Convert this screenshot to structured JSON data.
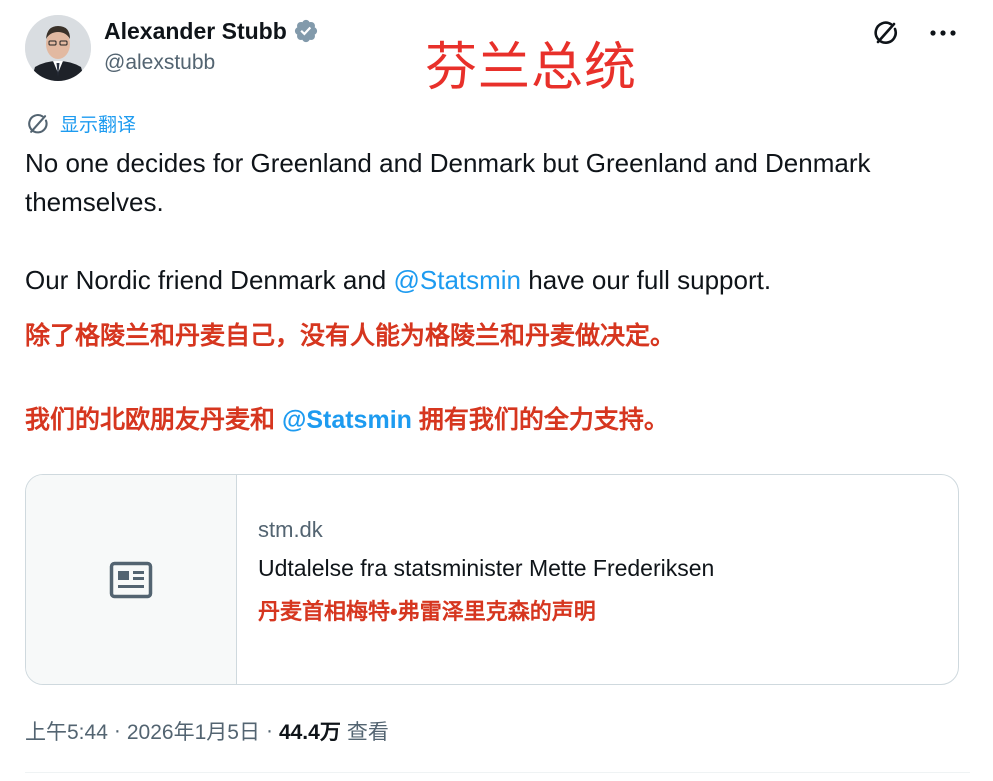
{
  "author": {
    "name": "Alexander Stubb",
    "handle": "@alexstubb",
    "verified_color": "#829aab"
  },
  "overlay_title": "芬兰总统",
  "icons": {
    "top_right": [
      "grok-icon",
      "more-options-icon"
    ],
    "translate": "translate-icon",
    "card_thumbnail": "article-icon"
  },
  "translate_label": "显示翻译",
  "tweet": {
    "line1": "No one decides for Greenland and Denmark but Greenland and Denmark themselves.",
    "line2_before": "Our Nordic friend Denmark and ",
    "line2_mention": "@Statsmin",
    "line2_after": " have our full support."
  },
  "translation": {
    "line1": "除了格陵兰和丹麦自己，没有人能为格陵兰和丹麦做决定。",
    "line2_before": "我们的北欧朋友丹麦和 ",
    "line2_mention": "@Statsmin",
    "line2_after": " 拥有我们的全力支持。"
  },
  "card": {
    "domain": "stm.dk",
    "title": "Udtalelse fra statsminister Mette Frederiksen",
    "translation": "丹麦首相梅特•弗雷泽里克森的声明"
  },
  "meta": {
    "time": "上午5:44",
    "sep1": "·",
    "date": "2026年1月5日",
    "sep2": "·",
    "views": "44.4万",
    "views_label": "查看"
  },
  "colors": {
    "link": "#1d9bf0",
    "annotation_red": "#d6361f",
    "secondary_text": "#536471"
  }
}
